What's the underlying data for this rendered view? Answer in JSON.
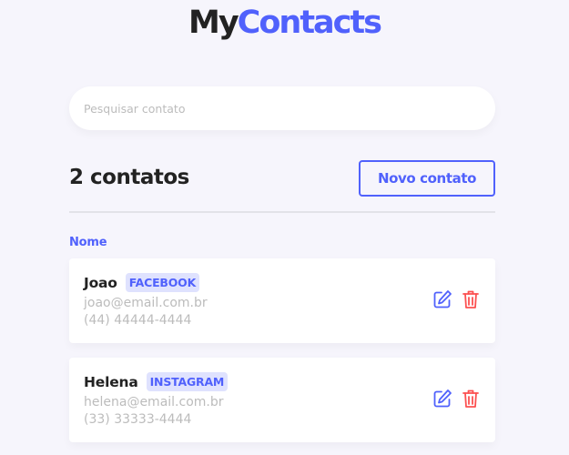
{
  "logo": {
    "part1": "My",
    "part2": "Contacts"
  },
  "search": {
    "placeholder": "Pesquisar contato",
    "value": ""
  },
  "header": {
    "count_label": "2 contatos",
    "new_button": "Novo contato"
  },
  "list": {
    "sort_label": "Nome",
    "contacts": [
      {
        "name": "Joao",
        "category": "FACEBOOK",
        "email": "joao@email.com.br",
        "phone": "(44) 44444-4444"
      },
      {
        "name": "Helena",
        "category": "INSTAGRAM",
        "email": "helena@email.com.br",
        "phone": "(33) 33333-4444"
      }
    ]
  },
  "icons": {
    "edit": "edit-icon",
    "delete": "trash-icon"
  },
  "colors": {
    "primary": "#5061fc",
    "danger": "#fc5050",
    "background": "#f6f5fc",
    "muted": "#bcbcbc"
  }
}
